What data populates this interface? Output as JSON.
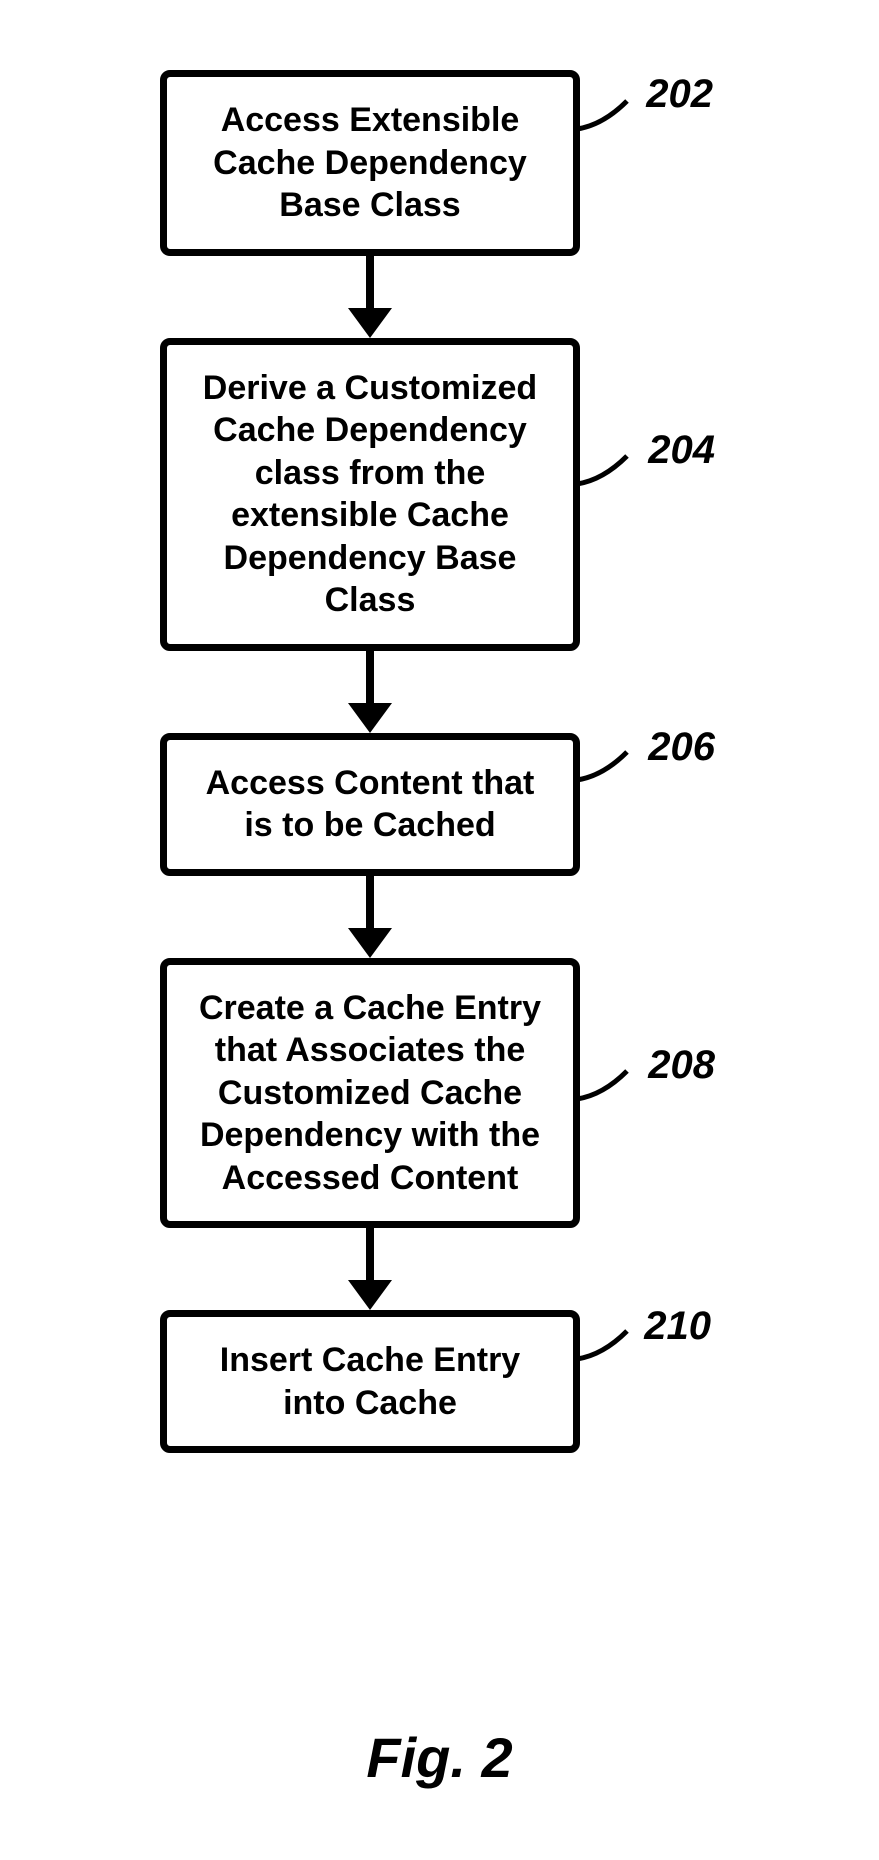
{
  "figure_caption": "Fig. 2",
  "steps": [
    {
      "ref": "202",
      "text": "Access Extensible Cache Dependency Base Class"
    },
    {
      "ref": "204",
      "text": "Derive a Customized Cache Dependency class from the extensible Cache Dependency Base Class"
    },
    {
      "ref": "206",
      "text": "Access Content that is to be Cached"
    },
    {
      "ref": "208",
      "text": "Create a Cache Entry that Associates the Customized Cache Dependency with the Accessed Content"
    },
    {
      "ref": "210",
      "text": "Insert Cache Entry into Cache"
    }
  ]
}
